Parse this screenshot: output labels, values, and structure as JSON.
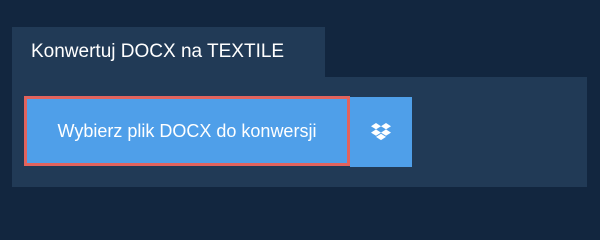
{
  "tab": {
    "title": "Konwertuj DOCX na TEXTILE"
  },
  "upload": {
    "select_file_label": "Wybierz plik DOCX do konwersji",
    "dropbox_icon": "dropbox-icon"
  },
  "colors": {
    "background": "#12263f",
    "panel": "#213a56",
    "button": "#4f9fe9",
    "focus_border": "#e2635d",
    "text": "#ffffff"
  }
}
